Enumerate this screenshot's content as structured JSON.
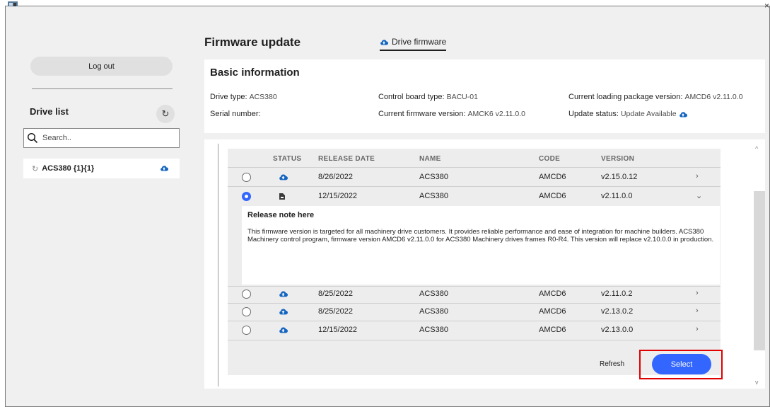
{
  "window": {
    "close_glyph": "×",
    "app_icon": "app-icon"
  },
  "sidebar": {
    "logout_label": "Log out",
    "drive_list_title": "Drive list",
    "search_placeholder": "Search..",
    "drives": [
      {
        "name": "ACS380 {1}{1}",
        "status_icon": "cloud-upload-icon"
      }
    ]
  },
  "header": {
    "title": "Firmware update",
    "tab_label": "Drive firmware"
  },
  "basic_info": {
    "title": "Basic information",
    "drive_type_label": "Drive type:",
    "drive_type_value": "ACS380",
    "serial_label": "Serial number:",
    "serial_value": "",
    "control_board_label": "Control board type:",
    "control_board_value": "BACU-01",
    "current_fw_label": "Current firmware version:",
    "current_fw_value": "AMCK6 v2.11.0.0",
    "loading_pkg_label": "Current loading package version:",
    "loading_pkg_value": "AMCD6 v2.11.0.0",
    "update_status_label": "Update status:",
    "update_status_value": "Update Available"
  },
  "table": {
    "headers": {
      "status": "STATUS",
      "release_date": "RELEASE DATE",
      "name": "NAME",
      "code": "CODE",
      "version": "VERSION"
    },
    "rows": [
      {
        "selected": false,
        "status_icon": "cloud-upload-icon",
        "release_date": "8/26/2022",
        "name": "ACS380",
        "code": "AMCD6",
        "version": "v2.15.0.12",
        "chevron": "›"
      },
      {
        "selected": true,
        "status_icon": "installed-icon",
        "release_date": "12/15/2022",
        "name": "ACS380",
        "code": "AMCD6",
        "version": "v2.11.0.0",
        "chevron": "⌄"
      },
      {
        "selected": false,
        "status_icon": "cloud-upload-icon",
        "release_date": "8/25/2022",
        "name": "ACS380",
        "code": "AMCD6",
        "version": "v2.11.0.2",
        "chevron": "›"
      },
      {
        "selected": false,
        "status_icon": "cloud-upload-icon",
        "release_date": "8/25/2022",
        "name": "ACS380",
        "code": "AMCD6",
        "version": "v2.13.0.2",
        "chevron": "›"
      },
      {
        "selected": false,
        "status_icon": "cloud-upload-icon",
        "release_date": "12/15/2022",
        "name": "ACS380",
        "code": "AMCD6",
        "version": "v2.13.0.0",
        "chevron": "›"
      }
    ]
  },
  "release_note": {
    "title": "Release note here",
    "text": "This firmware version is targeted for all machinery drive customers. It provides reliable performance and ease of integration for machine builders. ACS380 Machinery control program, firmware version AMCD6 v2.11.0.0 for ACS380 Machinery drives frames R0-R4. This version will replace v2.10.0.0 in production."
  },
  "actions": {
    "refresh_label": "Refresh",
    "select_label": "Select"
  },
  "colors": {
    "accent": "#3366ff",
    "highlight": "#e00000",
    "cloud_icon": "#1565c0"
  }
}
